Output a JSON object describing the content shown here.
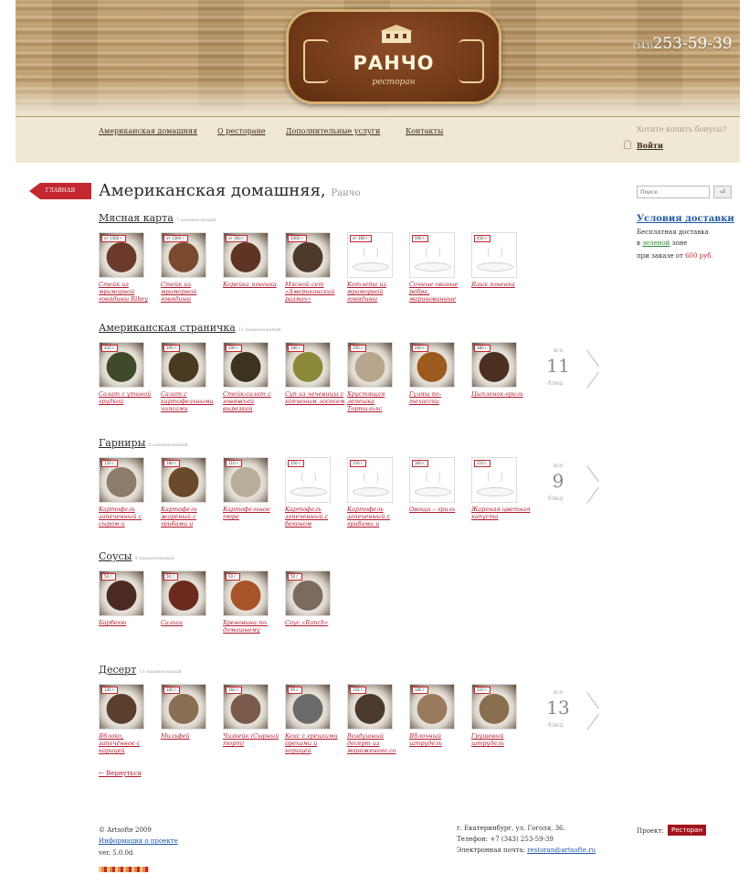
{
  "header": {
    "logo_title": "РАНЧО",
    "logo_subtitle": "ресторан",
    "phone_code": "(343)",
    "phone": "253-59-39"
  },
  "nav": {
    "items": [
      {
        "label": "Американская домашняя"
      },
      {
        "label": "О ресторане"
      },
      {
        "label": "Дополнительные услуги"
      },
      {
        "label": "Контакты"
      }
    ],
    "bonus_text": "Хотите копить бонусы?",
    "login": "Войти"
  },
  "page": {
    "home_tab": "ГЛАВНАЯ",
    "title": "Американская домашняя,",
    "subtitle": "Ранчо"
  },
  "sections": [
    {
      "title": "Мясная карта",
      "count_label": "7 наименований",
      "dishes": [
        {
          "weight": "от 1560 г.",
          "name": "Стейк из мраморной говядины Ribey",
          "photo": "#6b3a2a"
        },
        {
          "weight": "от 1360 г.",
          "name": "Стейк из мраморной говядины",
          "photo": "#7a4a2f"
        },
        {
          "weight": "от 360 г.",
          "name": "Корейка ягненка",
          "photo": "#5e3423"
        },
        {
          "weight": "2000 г.",
          "name": "Мясной сет «Американский размах»",
          "photo": "#4d3a2a"
        },
        {
          "weight": "от 360 г.",
          "name": "Котлета из мраморной говядины",
          "photo": null
        },
        {
          "weight": "590 г.",
          "name": "Сочные свиные ребра, маринованные",
          "photo": null
        },
        {
          "weight": "450 г.",
          "name": "Язык ягненка",
          "photo": null
        }
      ]
    },
    {
      "title": "Американская страничка",
      "count_label": "11 наименований",
      "more_label": "все",
      "more_count": "11",
      "more_unit": "блюд",
      "dishes": [
        {
          "weight": "420 г.",
          "name": "Салат с утиной грудкой",
          "photo": "#3f4a2a"
        },
        {
          "weight": "295 г.",
          "name": "Салат с картофельными чипсами",
          "photo": "#4a3a22"
        },
        {
          "weight": "290 г.",
          "name": "Стейк-салат с говяжьей вырезкой",
          "photo": "#3b3320"
        },
        {
          "weight": "180 г.",
          "name": "Суп из чечевицы с копченым лососем",
          "photo": "#8a8a3a"
        },
        {
          "weight": "350 г.",
          "name": "Хрустящая лепешка Тортильяс",
          "photo": "#b8a58e"
        },
        {
          "weight": "260 г.",
          "name": "Гуляш по-техасски",
          "photo": "#9c5a1e"
        },
        {
          "weight": "380 г.",
          "name": "Цыпленок-гриль",
          "photo": "#4b3022"
        }
      ]
    },
    {
      "title": "Гарниры",
      "count_label": "9 наименований",
      "more_label": "все",
      "more_count": "9",
      "more_unit": "блюд",
      "dishes": [
        {
          "weight": "150 г.",
          "name": "Картофель запеченный с сыром и",
          "photo": "#8d7c6a"
        },
        {
          "weight": "180 г.",
          "name": "Картофель жареный с грибами и",
          "photo": "#6a4a2a"
        },
        {
          "weight": "110 г.",
          "name": "Картофельное пюре",
          "photo": "#b8ad98"
        },
        {
          "weight": "150 г.",
          "name": "Картофель запеченный с беконом",
          "photo": null
        },
        {
          "weight": "150 г.",
          "name": "Картофель запеченный с грибами и",
          "photo": null
        },
        {
          "weight": "160 г.",
          "name": "Овощи – гриль",
          "photo": null
        },
        {
          "weight": "210 г.",
          "name": "Жареная цветная капуста",
          "photo": null
        }
      ]
    },
    {
      "title": "Соусы",
      "count_label": "4 наименования",
      "dishes": [
        {
          "weight": "50 г.",
          "name": "Барбекю",
          "photo": "#4a2a22"
        },
        {
          "weight": "50 г.",
          "name": "Сальса",
          "photo": "#6a2a1e"
        },
        {
          "weight": "50 г.",
          "name": "Хреновина по-домашнему",
          "photo": "#a8542a"
        },
        {
          "weight": "50 г.",
          "name": "Соус «Ranch»",
          "photo": "#7a6a60"
        }
      ]
    },
    {
      "title": "Десерт",
      "count_label": "13 наименований",
      "more_label": "все",
      "more_count": "13",
      "more_unit": "блюд",
      "dishes": [
        {
          "weight": "140 г.",
          "name": "Яблоко, запечённое с корицей",
          "photo": "#5a3e2e"
        },
        {
          "weight": "185 г.",
          "name": "Мильфей",
          "photo": "#8a6e54"
        },
        {
          "weight": "160 г.",
          "name": "Чизкейк (Сырный торт)",
          "photo": "#7a5a4a"
        },
        {
          "weight": "95 г.",
          "name": "Кекс с грецкими орехами и корицей",
          "photo": "#6a6a6a"
        },
        {
          "weight": "150 г.",
          "name": "Воздушный десерт из мороженого со",
          "photo": "#4a3a30"
        },
        {
          "weight": "185 г.",
          "name": "Яблочный штрудель",
          "photo": "#9a7a5e"
        },
        {
          "weight": "210 г.",
          "name": "Грушевый штрудель",
          "photo": "#8a6e50"
        }
      ]
    }
  ],
  "back_link": "← Вернуться",
  "sidebar": {
    "search_placeholder": "Поиск",
    "search_button": "⏎",
    "delivery_title": "Условия доставки",
    "delivery_line1": "Бесплатная доставка",
    "delivery_line2_a": "в",
    "delivery_line2_zone": "зеленой",
    "delivery_line2_b": "зоне",
    "delivery_line3_a": "при заказе от",
    "delivery_line3_amount": "600 руб."
  },
  "footer": {
    "copyright": "© Artsofte 2009",
    "project_info": "Информация о проекте",
    "version": "ver. 5.0.0d",
    "address": "г. Екатеринбург, ул. Гоголя, 36.",
    "phone": "Телефон: +7 (343) 253-59-39",
    "email_label": "Электронная почта:",
    "email": "restoran@artsofte.ru",
    "project_label": "Проект:",
    "project_badge": "Ресторан"
  },
  "colors": {
    "accent": "#c4272f",
    "link": "#b3182d",
    "delivery": "#1f57a5",
    "nav_bg": "#efe8d4"
  }
}
